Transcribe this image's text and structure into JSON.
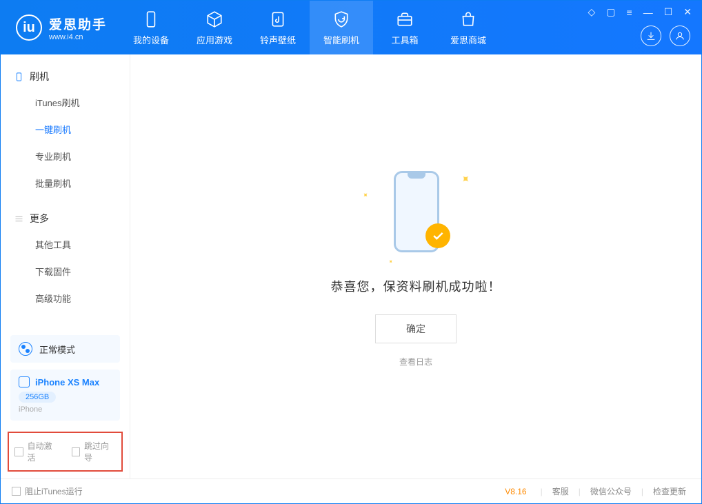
{
  "brand": {
    "name": "爱思助手",
    "url": "www.i4.cn"
  },
  "header_tabs": [
    {
      "label": "我的设备"
    },
    {
      "label": "应用游戏"
    },
    {
      "label": "铃声壁纸"
    },
    {
      "label": "智能刷机",
      "active": true
    },
    {
      "label": "工具箱"
    },
    {
      "label": "爱思商城"
    }
  ],
  "sidebar": {
    "group1": {
      "title": "刷机"
    },
    "group1_items": [
      {
        "label": "iTunes刷机"
      },
      {
        "label": "一键刷机",
        "active": true
      },
      {
        "label": "专业刷机"
      },
      {
        "label": "批量刷机"
      }
    ],
    "group2": {
      "title": "更多"
    },
    "group2_items": [
      {
        "label": "其他工具"
      },
      {
        "label": "下载固件"
      },
      {
        "label": "高级功能"
      }
    ],
    "mode": "正常模式",
    "device": {
      "name": "iPhone XS Max",
      "capacity": "256GB",
      "type": "iPhone"
    },
    "options": {
      "auto_activate": "自动激活",
      "skip_guide": "跳过向导"
    }
  },
  "main": {
    "success_text": "恭喜您，保资料刷机成功啦！",
    "ok_button": "确定",
    "view_log": "查看日志"
  },
  "footer": {
    "block_itunes": "阻止iTunes运行",
    "version": "V8.16",
    "links": {
      "support": "客服",
      "wechat": "微信公众号",
      "check_update": "检查更新"
    }
  }
}
